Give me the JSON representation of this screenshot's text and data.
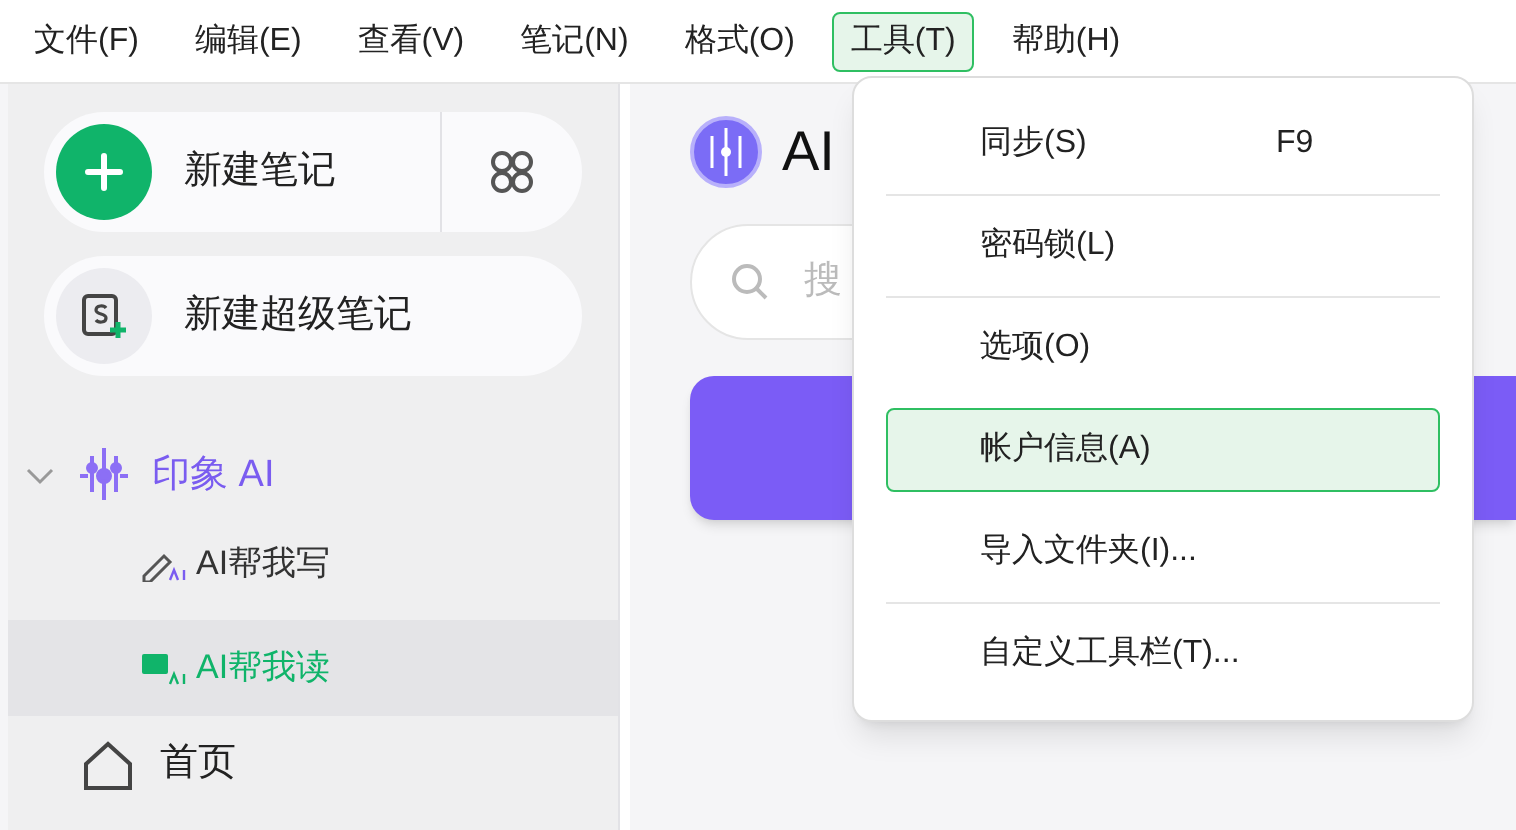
{
  "menu_bar": [
    {
      "label": "文件(F)",
      "selected": false
    },
    {
      "label": "编辑(E)",
      "selected": false
    },
    {
      "label": "查看(V)",
      "selected": false
    },
    {
      "label": "笔记(N)",
      "selected": false
    },
    {
      "label": "格式(O)",
      "selected": false
    },
    {
      "label": "工具(T)",
      "selected": true
    },
    {
      "label": "帮助(H)",
      "selected": false
    }
  ],
  "sidebar": {
    "new_note": "新建笔记",
    "new_super_note": "新建超级笔记",
    "section": {
      "label": "印象 AI",
      "expanded": true,
      "children": [
        {
          "label": "AI帮我写",
          "selected": false
        },
        {
          "label": "AI帮我读",
          "selected": true
        }
      ]
    },
    "home": "首页"
  },
  "main": {
    "title": "AI",
    "search": {
      "placeholder": "搜"
    }
  },
  "dropdown": [
    {
      "label": "同步(S)",
      "shortcut": "F9",
      "selected": false
    },
    {
      "label": "密码锁(L)",
      "selected": false
    },
    {
      "label": "选项(O)",
      "selected": false
    },
    {
      "label": "帐户信息(A)",
      "selected": true
    },
    {
      "label": "导入文件夹(I)...",
      "selected": false
    },
    {
      "label": "自定义工具栏(T)...",
      "selected": false
    }
  ]
}
